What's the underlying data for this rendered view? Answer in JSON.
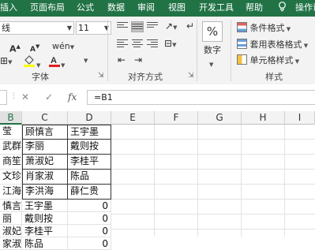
{
  "ribbon_tabs": [
    "插入",
    "页面布局",
    "公式",
    "数据",
    "审阅",
    "视图",
    "开发工具",
    "帮助",
    "操作说"
  ],
  "font": {
    "name": "线",
    "size": "11"
  },
  "font_group_label": "字体",
  "alignment_group_label": "对齐方式",
  "number": {
    "symbol": "%",
    "label": "数字"
  },
  "styles": {
    "conditional": "条件格式",
    "table": "套用表格格式",
    "cell": "单元格样式",
    "label": "样式"
  },
  "formula_bar": {
    "cancel": "✕",
    "enter": "✓",
    "fx": "fx",
    "formula": "=B1"
  },
  "columns": {
    "B": "B",
    "C": "C",
    "D": "D",
    "E": "E",
    "F": "F",
    "G": "G",
    "H": "H",
    "I": "I"
  },
  "grid": {
    "r1": {
      "b": "莹",
      "c": "顾慎言",
      "d": "王宇墨"
    },
    "r2": {
      "b": "武群",
      "c": "李丽",
      "d": "戴则按"
    },
    "r3": {
      "b": "商笙",
      "c": "萧淑妃",
      "d": "李桂平"
    },
    "r4": {
      "b": "文珍",
      "c": "肖家淑",
      "d": "陈品"
    },
    "r5": {
      "b": "江海",
      "c": "李洪海",
      "d": "薛仁贵"
    },
    "r6": {
      "b": "慎言",
      "c": "王宇墨",
      "d": "0"
    },
    "r7": {
      "b": "丽",
      "c": "戴则按",
      "d": "0"
    },
    "r8": {
      "b": "淑妃",
      "c": "李桂平",
      "d": "0"
    },
    "r9": {
      "b": "家淑",
      "c": "陈品",
      "d": "0"
    }
  }
}
